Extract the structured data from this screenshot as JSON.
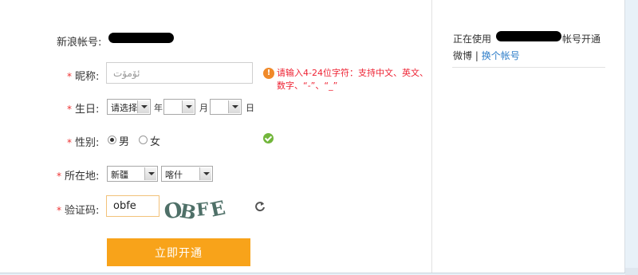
{
  "account": {
    "prefix": "新浪帐号:"
  },
  "form": {
    "nickname": {
      "label": "昵称:",
      "value": "ئۆمۆت",
      "tip": "请输入4-24位字符：支持中文、英文、",
      "tip2": "数字、“-”、“_”"
    },
    "birthday": {
      "label": "生日:",
      "year_value": "请选择",
      "year_unit": "年",
      "month_unit": "月",
      "day_unit": "日"
    },
    "gender": {
      "label": "性别:",
      "male": "男",
      "female": "女",
      "selected": "male"
    },
    "location": {
      "label": "所在地:",
      "province": "新疆",
      "city": "喀什"
    },
    "captcha": {
      "label": "验证码:",
      "value": "obfe",
      "image_text": "OBFE"
    },
    "submit_label": "立即开通"
  },
  "sidebar": {
    "using_prefix": "正在使用",
    "using_suffix": "帐号开通",
    "weibo": "微博",
    "separator": "|",
    "switch_account": "换个帐号"
  }
}
